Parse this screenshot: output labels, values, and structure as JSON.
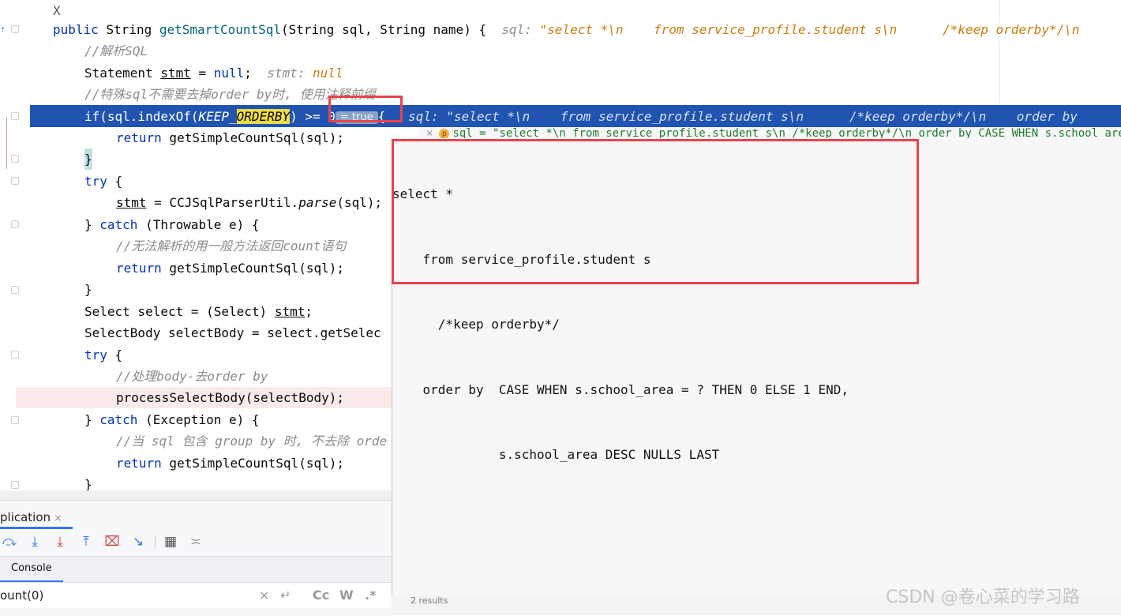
{
  "editor": {
    "line_x": "X",
    "method_signature": {
      "kw_public": "public",
      "type_string": "String",
      "method": "getSmartCountSql",
      "params": "(String sql, String name) {",
      "hint_label": "sql:",
      "hint_value": "\"select *\\n    from service_profile.student s\\n      /*keep orderby*/\\n"
    },
    "comment_parse": "//解析SQL",
    "stmt_decl": {
      "type": "Statement ",
      "var": "stmt",
      "rest": " = ",
      "null_kw": "null",
      "semi": ";",
      "hint_label": "stmt:",
      "hint_value": "null"
    },
    "comment_special": "//特殊sql不需要去掉order by时, 使用注释前缀",
    "if_line": {
      "prefix": "if(sql.indexOf(",
      "keep_prefix": "KEEP_",
      "orderby": "ORDERBY",
      "suffix": ") >= 0",
      "badge": "= true",
      "brace": "{",
      "hint": "sql: \"select *\\n    from service_profile.student s\\n      /*keep orderby*/\\n    order by"
    },
    "return_simple_1": {
      "kw": "return",
      "call": " getSimpleCountSql(sql);"
    },
    "close_brace_1": "}",
    "try_1": {
      "kw": "try",
      "rest": " {"
    },
    "stmt_parse": {
      "var": "stmt",
      "mid": " = CCJSqlParserUtil.",
      "method": "parse",
      "rest": "(sql);"
    },
    "catch_1": {
      "pre": "} ",
      "kw": "catch",
      "rest": " (Throwable e) {"
    },
    "comment_fail": "//无法解析的用一般方法返回count语句",
    "return_simple_2": {
      "kw": "return",
      "call": " getSimpleCountSql(sql);"
    },
    "close_brace_2": "}",
    "select_line": {
      "pre": "Select select = (Select) ",
      "var": "stmt",
      "semi": ";"
    },
    "selectbody_line": "SelectBody selectBody = select.getSelec",
    "try_2": {
      "kw": "try",
      "rest": " {"
    },
    "comment_body": "//处理body-去order by",
    "process_line": "processSelectBody(selectBody);",
    "catch_2": {
      "pre": "} ",
      "kw": "catch",
      "rest": " (Exception e) {"
    },
    "comment_group": "//当 sql 包含 group by 时, 不去除 orde",
    "return_simple_3": {
      "kw": "return",
      "call": " getSimpleCountSql(sql);"
    },
    "close_brace_3": "}"
  },
  "popup": {
    "header_close": "×",
    "header_icon": "p",
    "header_text": "sql = \"select *\\n    from service_profile.student s\\n      /*keep orderby*/\\n    order by  CASE WHEN s.school_area = ? T",
    "lines": [
      "select *",
      "    from service_profile.student s",
      "      /*keep orderby*/",
      "    order by  CASE WHEN s.school_area = ? THEN 0 ELSE 1 END,",
      "              s.school_area DESC NULLS LAST"
    ]
  },
  "bottom_panel": {
    "tab_label": "plication",
    "tab_close": "×",
    "console_label": "Console",
    "search_text": "ount(0)",
    "results_text": "2 results",
    "icons": [
      "step-over-icon",
      "step-into-icon",
      "force-step-into-icon",
      "step-out-icon",
      "drop-frame-icon",
      "run-to-cursor-icon",
      "evaluate-icon",
      "trace-icon"
    ]
  },
  "search_controls": {
    "clear": "×",
    "replace": "↵",
    "match_case": "Cc",
    "words": "W",
    "regex": ".*"
  },
  "watermark": "CSDN @卷心菜的学习路"
}
